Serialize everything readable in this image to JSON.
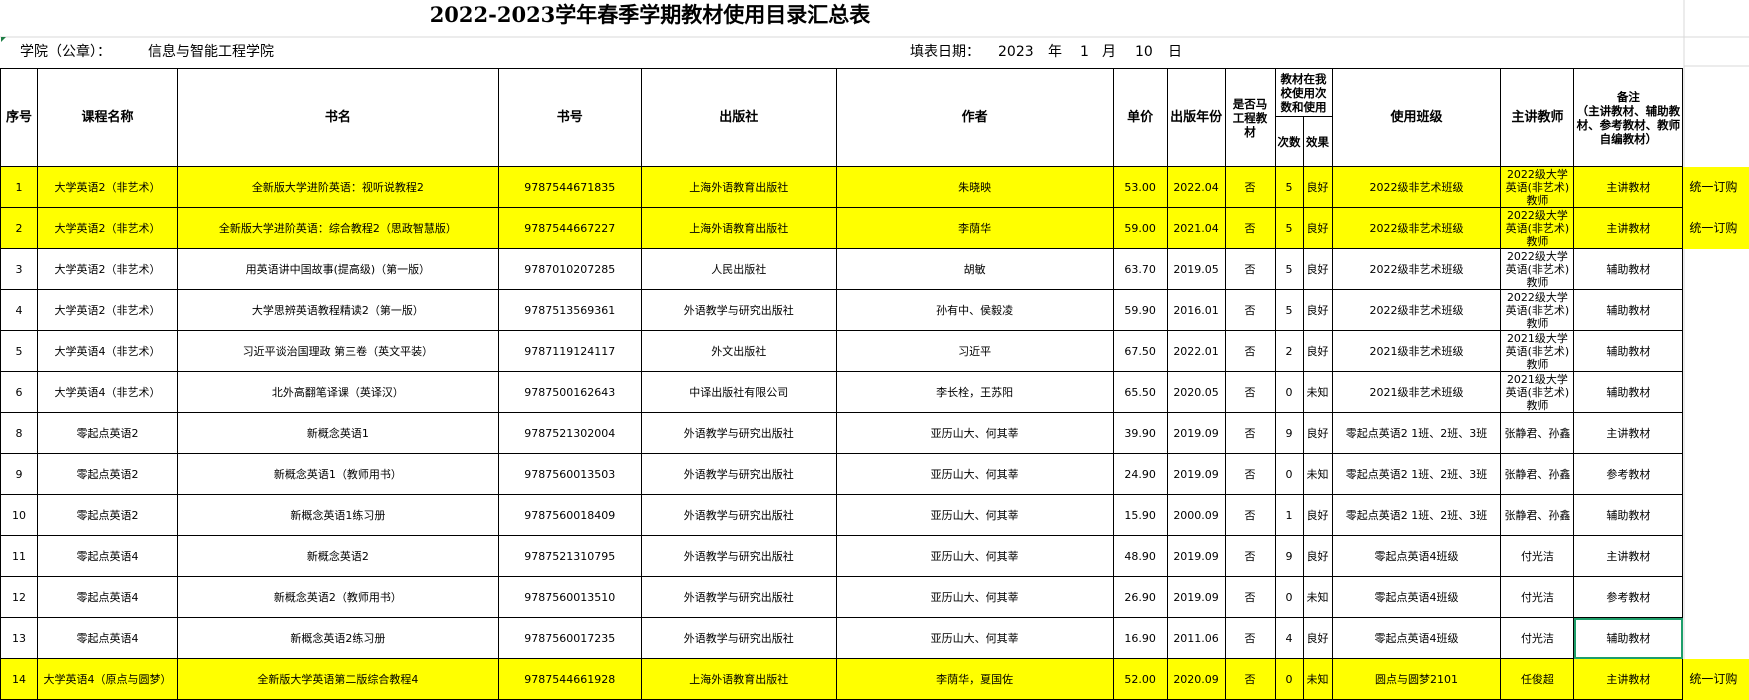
{
  "title": "2022-2023学年春季学期教材使用目录汇总表",
  "college_label": "学院（公章）：",
  "college_name": "信息与智能工程学院",
  "date_label": "填表日期：",
  "date_year": "2023",
  "date_year_unit": "年",
  "date_month": "1",
  "date_month_unit": "月",
  "date_day": "10",
  "date_day_unit": "日",
  "headers": {
    "no": "序号",
    "course": "课程名称",
    "book": "书名",
    "isbn": "书号",
    "publisher": "出版社",
    "author": "作者",
    "price": "单价",
    "pub_year": "出版年份",
    "marx": "是否马工程教材",
    "usage_group": "教材在我校使用次数和使用",
    "times": "次数",
    "effect": "效果",
    "classes": "使用班级",
    "teacher": "主讲教师",
    "remark": "备注\n（主讲教材、辅助教材、参考教材、教师自编教材）"
  },
  "rows": [
    {
      "no": "1",
      "course": "大学英语2（非艺术）",
      "book": "全新版大学进阶英语：视听说教程2",
      "isbn": "9787544671835",
      "publisher": "上海外语教育出版社",
      "author": "朱晓映",
      "price": "53.00",
      "year": "2022.04",
      "marx": "否",
      "times": "5",
      "effect": "良好",
      "classes": "2022级非艺术班级",
      "teacher": "2022级大学英语(非艺术)教师",
      "remark": "主讲教材",
      "extra": "统一订购",
      "hl": true
    },
    {
      "no": "2",
      "course": "大学英语2（非艺术）",
      "book": "全新版大学进阶英语：综合教程2（思政智慧版）",
      "isbn": "9787544667227",
      "publisher": "上海外语教育出版社",
      "author": "李荫华",
      "price": "59.00",
      "year": "2021.04",
      "marx": "否",
      "times": "5",
      "effect": "良好",
      "classes": "2022级非艺术班级",
      "teacher": "2022级大学英语(非艺术)教师",
      "remark": "主讲教材",
      "extra": "统一订购",
      "hl": true
    },
    {
      "no": "3",
      "course": "大学英语2（非艺术）",
      "book": "用英语讲中国故事(提高级)（第一版）",
      "isbn": "9787010207285",
      "publisher": "人民出版社",
      "author": "胡敏",
      "price": "63.70",
      "year": "2019.05",
      "marx": "否",
      "times": "5",
      "effect": "良好",
      "classes": "2022级非艺术班级",
      "teacher": "2022级大学英语(非艺术)教师",
      "remark": "辅助教材",
      "extra": "",
      "hl": false
    },
    {
      "no": "4",
      "course": "大学英语2（非艺术）",
      "book": "大学思辨英语教程精读2（第一版）",
      "isbn": "9787513569361",
      "publisher": "外语教学与研究出版社",
      "author": "孙有中、侯毅凌",
      "price": "59.90",
      "year": "2016.01",
      "marx": "否",
      "times": "5",
      "effect": "良好",
      "classes": "2022级非艺术班级",
      "teacher": "2022级大学英语(非艺术)教师",
      "remark": "辅助教材",
      "extra": "",
      "hl": false
    },
    {
      "no": "5",
      "course": "大学英语4（非艺术）",
      "book": "习近平谈治国理政 第三卷（英文平装）",
      "isbn": "9787119124117",
      "publisher": "外文出版社",
      "author": "习近平",
      "price": "67.50",
      "year": "2022.01",
      "marx": "否",
      "times": "2",
      "effect": "良好",
      "classes": "2021级非艺术班级",
      "teacher": "2021级大学英语(非艺术)教师",
      "remark": "辅助教材",
      "extra": "",
      "hl": false
    },
    {
      "no": "6",
      "course": "大学英语4（非艺术）",
      "book": "北外高翻笔译课（英译汉）",
      "isbn": "9787500162643",
      "publisher": "中译出版社有限公司",
      "author": "李长栓，王苏阳",
      "price": "65.50",
      "year": "2020.05",
      "marx": "否",
      "times": "0",
      "effect": "未知",
      "classes": "2021级非艺术班级",
      "teacher": "2021级大学英语(非艺术)教师",
      "remark": "辅助教材",
      "extra": "",
      "hl": false
    },
    {
      "no": "8",
      "course": "零起点英语2",
      "book": "新概念英语1",
      "isbn": "9787521302004",
      "publisher": "外语教学与研究出版社",
      "author": "亚历山大、何其莘",
      "price": "39.90",
      "year": "2019.09",
      "marx": "否",
      "times": "9",
      "effect": "良好",
      "classes": "零起点英语2 1班、2班、3班",
      "teacher": "张静君、孙鑫",
      "remark": "主讲教材",
      "extra": "",
      "hl": false
    },
    {
      "no": "9",
      "course": "零起点英语2",
      "book": "新概念英语1（教师用书）",
      "isbn": "9787560013503",
      "publisher": "外语教学与研究出版社",
      "author": "亚历山大、何其莘",
      "price": "24.90",
      "year": "2019.09",
      "marx": "否",
      "times": "0",
      "effect": "未知",
      "classes": "零起点英语2 1班、2班、3班",
      "teacher": "张静君、孙鑫",
      "remark": "参考教材",
      "extra": "",
      "hl": false
    },
    {
      "no": "10",
      "course": "零起点英语2",
      "book": "新概念英语1练习册",
      "isbn": "9787560018409",
      "publisher": "外语教学与研究出版社",
      "author": "亚历山大、何其莘",
      "price": "15.90",
      "year": "2000.09",
      "marx": "否",
      "times": "1",
      "effect": "良好",
      "classes": "零起点英语2 1班、2班、3班",
      "teacher": "张静君、孙鑫",
      "remark": "辅助教材",
      "extra": "",
      "hl": false
    },
    {
      "no": "11",
      "course": "零起点英语4",
      "book": "新概念英语2",
      "isbn": "9787521310795",
      "publisher": "外语教学与研究出版社",
      "author": "亚历山大、何其莘",
      "price": "48.90",
      "year": "2019.09",
      "marx": "否",
      "times": "9",
      "effect": "良好",
      "classes": "零起点英语4班级",
      "teacher": "付光洁",
      "remark": "主讲教材",
      "extra": "",
      "hl": false
    },
    {
      "no": "12",
      "course": "零起点英语4",
      "book": "新概念英语2（教师用书）",
      "isbn": "9787560013510",
      "publisher": "外语教学与研究出版社",
      "author": "亚历山大、何其莘",
      "price": "26.90",
      "year": "2019.09",
      "marx": "否",
      "times": "0",
      "effect": "未知",
      "classes": "零起点英语4班级",
      "teacher": "付光洁",
      "remark": "参考教材",
      "extra": "",
      "hl": false
    },
    {
      "no": "13",
      "course": "零起点英语4",
      "book": "新概念英语2练习册",
      "isbn": "9787560017235",
      "publisher": "外语教学与研究出版社",
      "author": "亚历山大、何其莘",
      "price": "16.90",
      "year": "2011.06",
      "marx": "否",
      "times": "4",
      "effect": "良好",
      "classes": "零起点英语4班级",
      "teacher": "付光洁",
      "remark": "辅助教材",
      "extra": "",
      "hl": false
    },
    {
      "no": "14",
      "course": "大学英语4（原点与圆梦）",
      "book": "全新版大学英语第二版综合教程4",
      "isbn": "9787544661928",
      "publisher": "上海外语教育出版社",
      "author": "李荫华，夏国佐",
      "price": "52.00",
      "year": "2020.09",
      "marx": "否",
      "times": "0",
      "effect": "未知",
      "classes": "圆点与圆梦2101",
      "teacher": "任俊超",
      "remark": "主讲教材",
      "extra": "统一订购",
      "hl": true
    }
  ]
}
